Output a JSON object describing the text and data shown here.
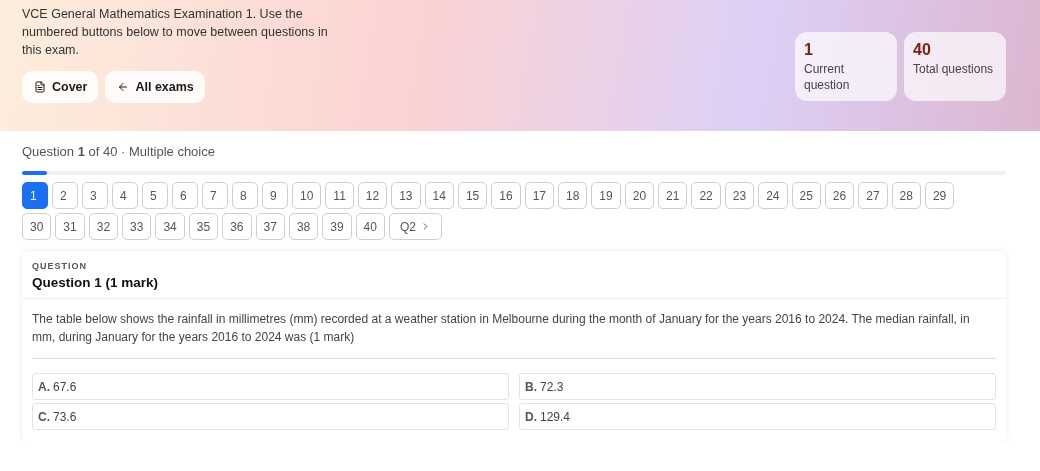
{
  "header": {
    "intro": "VCE General Mathematics Examination 1. Use the numbered buttons below to move between questions in this exam.",
    "buttons": [
      {
        "kind": "cover",
        "label": "Cover"
      },
      {
        "kind": "back",
        "label": "All exams"
      }
    ],
    "stats": [
      {
        "value": "1",
        "label": "Current question"
      },
      {
        "value": "40",
        "label": "Total questions"
      }
    ]
  },
  "progress": {
    "caption": "Question **1** of 40 · Multiple choice",
    "level": 0.025
  },
  "question_nav": [
    {
      "label": "1",
      "selected": true
    },
    {
      "label": "2",
      "selected": false
    },
    {
      "label": "3",
      "selected": false
    },
    {
      "label": "4",
      "selected": false
    },
    {
      "label": "5",
      "selected": false
    },
    {
      "label": "6",
      "selected": false
    },
    {
      "label": "7",
      "selected": false
    },
    {
      "label": "8",
      "selected": false
    },
    {
      "label": "9",
      "selected": false
    },
    {
      "label": "10",
      "selected": false
    },
    {
      "label": "11",
      "selected": false
    },
    {
      "label": "12",
      "selected": false
    },
    {
      "label": "13",
      "selected": false
    },
    {
      "label": "14",
      "selected": false
    },
    {
      "label": "15",
      "selected": false
    },
    {
      "label": "16",
      "selected": false
    },
    {
      "label": "17",
      "selected": false
    },
    {
      "label": "18",
      "selected": false
    },
    {
      "label": "19",
      "selected": false
    },
    {
      "label": "20",
      "selected": false
    },
    {
      "label": "21",
      "selected": false
    },
    {
      "label": "22",
      "selected": false
    },
    {
      "label": "23",
      "selected": false
    },
    {
      "label": "24",
      "selected": false
    },
    {
      "label": "25",
      "selected": false
    },
    {
      "label": "26",
      "selected": false
    },
    {
      "label": "27",
      "selected": false
    },
    {
      "label": "28",
      "selected": false
    },
    {
      "label": "29",
      "selected": false
    },
    {
      "label": "30",
      "selected": false
    },
    {
      "label": "31",
      "selected": false
    },
    {
      "label": "32",
      "selected": false
    },
    {
      "label": "33",
      "selected": false
    },
    {
      "label": "34",
      "selected": false
    },
    {
      "label": "35",
      "selected": false
    },
    {
      "label": "36",
      "selected": false
    },
    {
      "label": "37",
      "selected": false
    },
    {
      "label": "38",
      "selected": false
    },
    {
      "label": "39",
      "selected": false
    },
    {
      "label": "40",
      "selected": false
    }
  ],
  "next_button": {
    "label": "Q2"
  },
  "question": {
    "eyebrow": "QUESTION",
    "title": "Question 1 (1 mark)",
    "text": "The table below shows the rainfall in millimetres (mm) recorded at a weather station in Melbourne during the month of January for the years 2016 to 2024. The median rainfall, in mm, during January for the years 2016 to 2024 was (1 mark)",
    "options": [
      {
        "letter": "A.",
        "text": "67.6"
      },
      {
        "letter": "B.",
        "text": "72.3"
      },
      {
        "letter": "C.",
        "text": "73.6"
      },
      {
        "letter": "D.",
        "text": "129.4"
      }
    ]
  }
}
